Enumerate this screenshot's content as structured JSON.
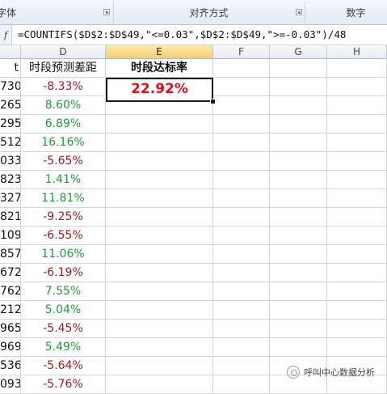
{
  "ribbon": {
    "groups": [
      {
        "label": "字体"
      },
      {
        "label": "对齐方式"
      },
      {
        "label": "数字"
      }
    ]
  },
  "formula_bar": {
    "fx_label": "f",
    "formula": "=COUNTIFS($D$2:$D$49,\"<=0.03\",$D$2:$D$49,\">=-0.03\")/48"
  },
  "columns": [
    "D",
    "E",
    "F",
    "G",
    "H"
  ],
  "sheet": {
    "header_row": {
      "col_c_fragment": "t",
      "col_d": "时段预测差距",
      "col_e": "时段达标率"
    },
    "result_value": "22.92%",
    "rows": [
      {
        "c": "730",
        "d": "-8.33%",
        "sign": "neg"
      },
      {
        "c": "265",
        "d": "8.60%",
        "sign": "pos"
      },
      {
        "c": "295",
        "d": "6.89%",
        "sign": "pos"
      },
      {
        "c": "512",
        "d": "16.16%",
        "sign": "pos"
      },
      {
        "c": "033",
        "d": "-5.65%",
        "sign": "neg"
      },
      {
        "c": "823",
        "d": "1.41%",
        "sign": "pos"
      },
      {
        "c": "327",
        "d": "11.81%",
        "sign": "pos"
      },
      {
        "c": "821",
        "d": "-9.25%",
        "sign": "neg"
      },
      {
        "c": "109",
        "d": "-6.55%",
        "sign": "neg"
      },
      {
        "c": "857",
        "d": "11.06%",
        "sign": "pos"
      },
      {
        "c": "672",
        "d": "-6.19%",
        "sign": "neg"
      },
      {
        "c": "762",
        "d": "7.55%",
        "sign": "pos"
      },
      {
        "c": "212",
        "d": "5.04%",
        "sign": "pos"
      },
      {
        "c": "965",
        "d": "-5.45%",
        "sign": "neg"
      },
      {
        "c": "969",
        "d": "5.49%",
        "sign": "pos"
      },
      {
        "c": "536",
        "d": "-5.64%",
        "sign": "neg"
      },
      {
        "c": "093",
        "d": "-5.76%",
        "sign": "neg"
      }
    ]
  },
  "watermark": {
    "text": "呼叫中心数据分析"
  },
  "colors": {
    "negative": "#a51a1f",
    "positive": "#1f9a3c",
    "result": "#e3101a"
  }
}
